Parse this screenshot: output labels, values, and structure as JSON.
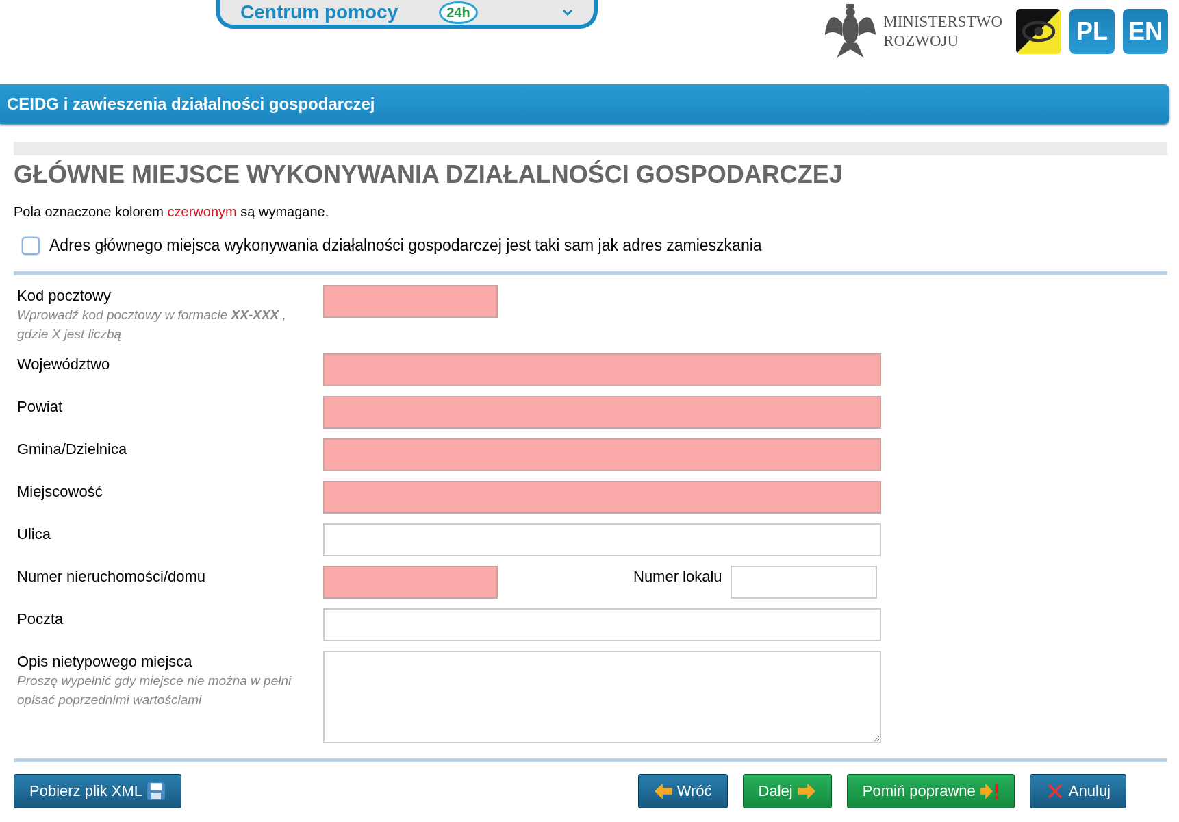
{
  "header": {
    "help_button": {
      "label": "Centrum pomocy",
      "badge": "24h"
    },
    "ministry_logo": {
      "lines": [
        "MINISTERSTWO",
        "ROZWOJU"
      ]
    },
    "languages": [
      {
        "label": "PL"
      },
      {
        "label": "EN"
      }
    ]
  },
  "section_bar": {
    "title": "CEIDG i zawieszenia działalności gospodarczej"
  },
  "form": {
    "title": "GŁÓWNE MIEJSCE WYKONYWANIA DZIAŁALNOŚCI GOSPODARCZEJ",
    "required_note": {
      "before": "Pola oznaczone kolorem",
      "highlight": "czerwonym",
      "after": "są wymagane."
    },
    "same_address": {
      "label": "Adres głównego miejsca wykonywania działalności gospodarczej jest taki sam jak adres zamieszkania",
      "checked": false
    },
    "fields": [
      {
        "kind": "short",
        "label": "Kod pocztowy",
        "hint": "Wprowadź kod pocztowy w formacie **XX-XXX** , gdzie X jest liczbą",
        "required": true
      },
      {
        "kind": "input",
        "label": "Województwo",
        "required": true
      },
      {
        "kind": "input",
        "label": "Powiat",
        "required": true
      },
      {
        "kind": "input",
        "label": "Gmina/Dzielnica",
        "required": true
      },
      {
        "kind": "input",
        "label": "Miejscowość",
        "required": true
      },
      {
        "kind": "input",
        "label": "Ulica",
        "required": false
      },
      {
        "kind": "pair",
        "label": "Numer nieruchomości/domu",
        "required": true,
        "second": {
          "label": "Numer lokalu",
          "required": false
        }
      },
      {
        "kind": "input",
        "label": "Poczta",
        "required": false
      },
      {
        "kind": "textarea",
        "label": "Opis nietypowego miejsca",
        "hint": "Proszę wypełnić gdy miejsce nie można w pełni opisać poprzednimi wartościami",
        "required": false
      }
    ]
  },
  "buttons": [
    {
      "kind": "xml",
      "label": "Pobierz plik XML"
    },
    {
      "kind": "back",
      "label": "Wróć"
    },
    {
      "kind": "next",
      "label": "Dalej"
    },
    {
      "kind": "skip",
      "label": "Pomiń poprawne"
    },
    {
      "kind": "cancel",
      "label": "Anuluj"
    }
  ]
}
